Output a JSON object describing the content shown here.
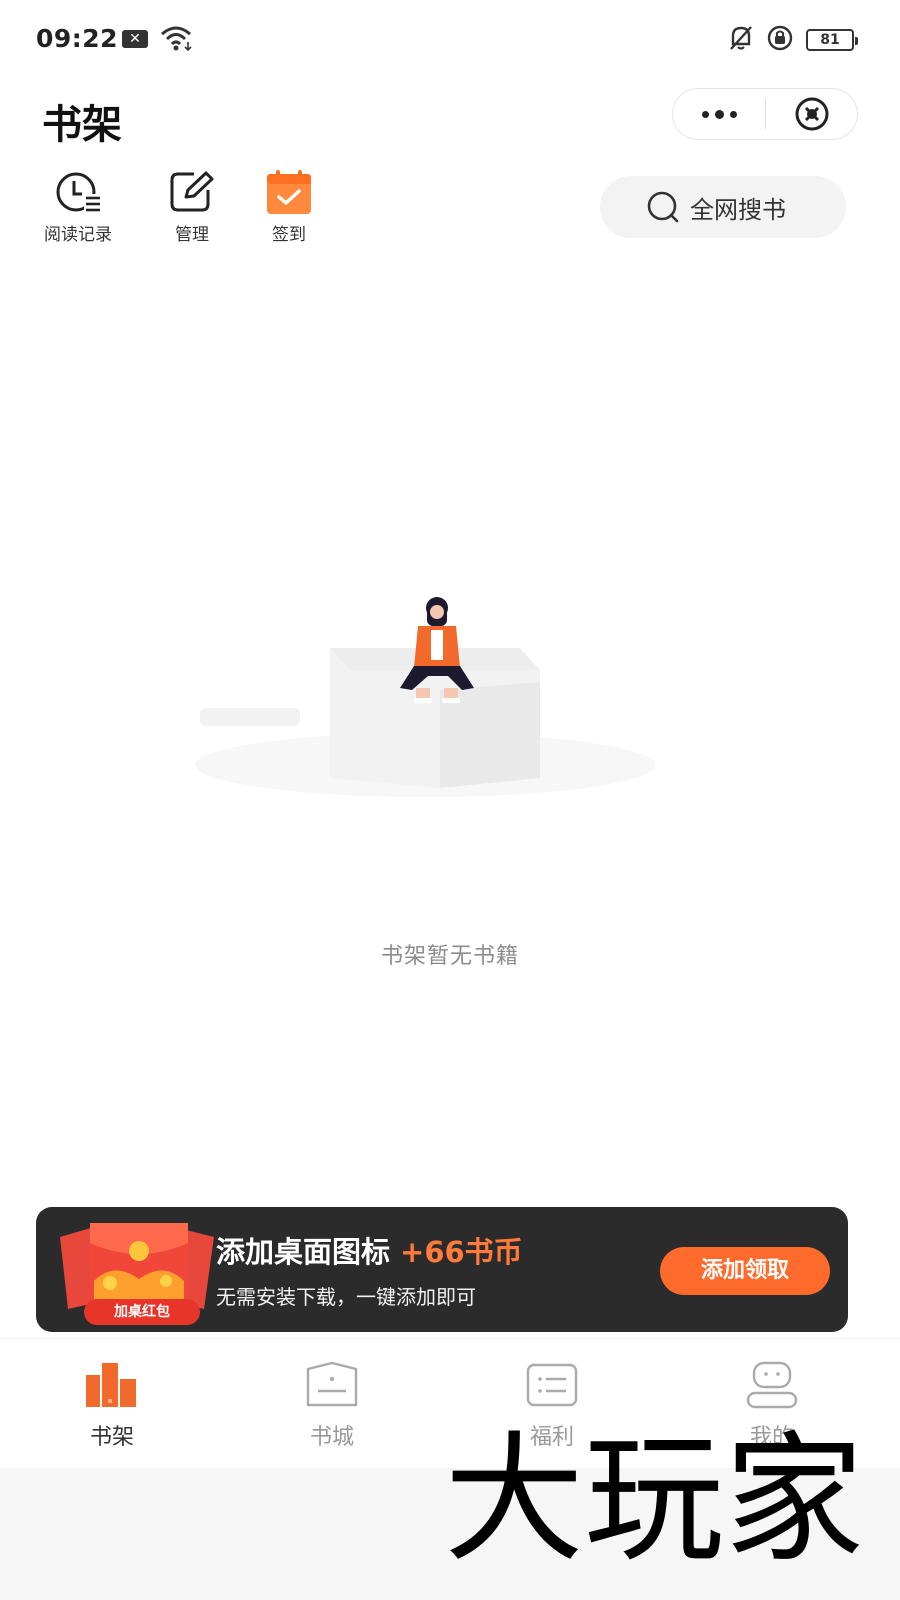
{
  "status_bar": {
    "time": "09:22",
    "notification_badge": "✕",
    "battery": "81",
    "icons": [
      "x-notification-icon",
      "wifi-icon",
      "mute-bell-icon",
      "rotation-lock-icon",
      "battery-icon"
    ]
  },
  "header": {
    "title": "书架"
  },
  "toolbar": {
    "items": [
      {
        "label": "阅读记录",
        "icon": "clock-list-icon"
      },
      {
        "label": "管理",
        "icon": "edit-icon"
      },
      {
        "label": "签到",
        "icon": "calendar-check-icon"
      }
    ],
    "search_label": "全网搜书"
  },
  "empty_state": {
    "text": "书架暂无书籍",
    "illustration": "girl-sitting-on-box"
  },
  "promo": {
    "title": "添加桌面图标",
    "coins": "+66书币",
    "subtitle": "无需安装下载，一键添加即可",
    "badge": "加桌红包",
    "button": "添加领取"
  },
  "tabbar": {
    "items": [
      {
        "label": "书架",
        "icon": "bookshelf-icon",
        "active": true
      },
      {
        "label": "书城",
        "icon": "bookstore-icon",
        "active": false
      },
      {
        "label": "福利",
        "icon": "welfare-list-icon",
        "active": false
      },
      {
        "label": "我的",
        "icon": "profile-icon",
        "active": false
      }
    ]
  },
  "watermark": "大玩家",
  "colors": {
    "accent": "#ff6b2c",
    "banner_bg": "#2b2b2b",
    "title_text": "#111111",
    "muted_text": "#8c8c8c"
  }
}
